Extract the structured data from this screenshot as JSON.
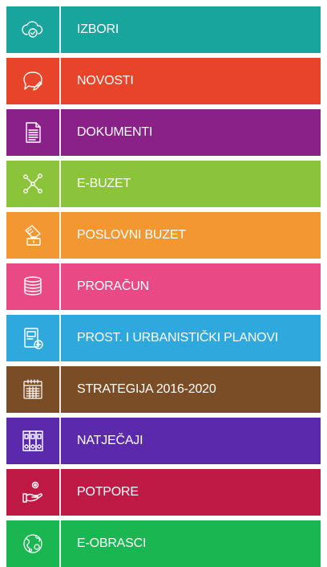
{
  "menu": {
    "items": [
      {
        "label": "IZBORI",
        "color": "#17a59d",
        "icon": "cloud-check-icon"
      },
      {
        "label": "NOVOSTI",
        "color": "#e8442a",
        "icon": "speech-bubble-pen-icon"
      },
      {
        "label": "DOKUMENTI",
        "color": "#8a2189",
        "icon": "document-icon"
      },
      {
        "label": "E-BUZET",
        "color": "#8bc43a",
        "icon": "network-icon"
      },
      {
        "label": "POSLOVNI BUZET",
        "color": "#f29732",
        "icon": "business-briefcase-icon"
      },
      {
        "label": "PRORAČUN",
        "color": "#e94a85",
        "icon": "coin-stack-icon"
      },
      {
        "label": "PROST. I URBANISTIČKI PLANOVI",
        "color": "#2ea8dd",
        "icon": "plan-add-icon"
      },
      {
        "label": "STRATEGIJA 2016-2020",
        "color": "#7b4d26",
        "icon": "calendar-grid-icon"
      },
      {
        "label": "NATJEČAJI",
        "color": "#5b2aac",
        "icon": "binders-icon"
      },
      {
        "label": "POTPORE",
        "color": "#bf1a46",
        "icon": "hand-coins-icon"
      },
      {
        "label": "E-OBRASCI",
        "color": "#1ab651",
        "icon": "globe-forms-icon"
      }
    ]
  }
}
